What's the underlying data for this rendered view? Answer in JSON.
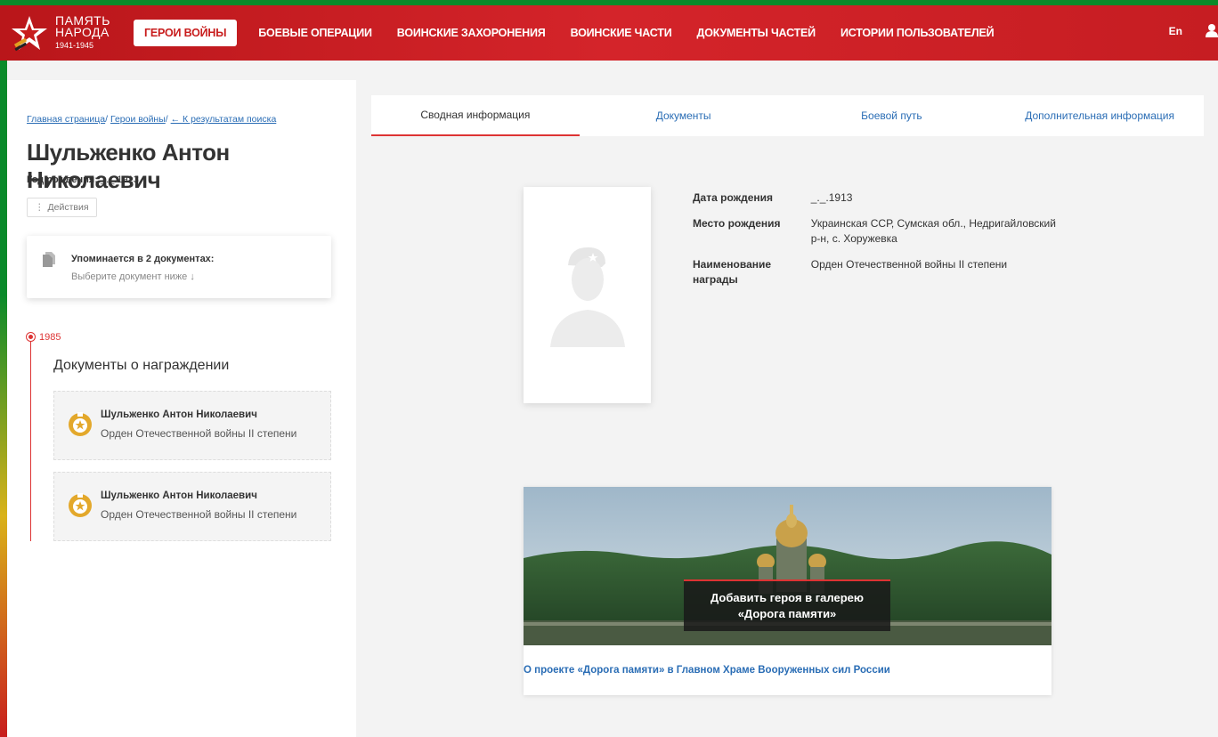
{
  "logo": {
    "line1": "ПАМЯТЬ",
    "line2": "НАРОДА",
    "years": "1941-1945"
  },
  "nav": {
    "items": [
      {
        "label": "ГЕРОИ ВОЙНЫ",
        "active": true
      },
      {
        "label": "БОЕВЫЕ ОПЕРАЦИИ"
      },
      {
        "label": "ВОИНСКИЕ ЗАХОРОНЕНИЯ"
      },
      {
        "label": "ВОИНСКИЕ ЧАСТИ"
      },
      {
        "label": "ДОКУМЕНТЫ ЧАСТЕЙ"
      },
      {
        "label": "ИСТОРИИ ПОЛЬЗОВАТЕЛЕЙ"
      }
    ],
    "lang": "En"
  },
  "breadcrumb": {
    "home": "Главная страница",
    "heroes": "Герои войны",
    "back": "← К результатам поиска",
    "sep": "/"
  },
  "hero": {
    "name": "Шульженко Антон Николаевич",
    "birth_label": "Год рождения:",
    "birth_value": " _._.1913",
    "actions": "Действия"
  },
  "mentions": {
    "title": "Упоминается в 2 документах:",
    "subtitle": "Выберите документ ниже ↓"
  },
  "timeline": {
    "year": "1985",
    "section_title": "Документы о награждении",
    "cards": [
      {
        "name": "Шульженко Антон Николаевич",
        "award": "Орден Отечественной войны II степени"
      },
      {
        "name": "Шульженко Антон Николаевич",
        "award": "Орден Отечественной войны II степени"
      }
    ]
  },
  "tabs": [
    {
      "label": "Сводная информация",
      "active": true
    },
    {
      "label": "Документы"
    },
    {
      "label": "Боевой путь"
    },
    {
      "label": "Дополнительная информация"
    }
  ],
  "info": [
    {
      "label": "Дата рождения",
      "value": "_._.1913"
    },
    {
      "label": "Место рождения",
      "value": "Украинская ССР, Сумская обл., Недригайловский р-н, с. Хоружевка"
    },
    {
      "label": "Наименование награды",
      "value": "Орден Отечественной войны II степени"
    }
  ],
  "promo": {
    "overlay_line1": "Добавить героя в галерею",
    "overlay_line2": "«Дорога памяти»",
    "link": "О проекте «Дорога памяти» в Главном Храме Вооруженных сил России"
  },
  "colors": {
    "brand_red": "#c81d1d",
    "link_blue": "#2a6db5",
    "frame_green": "#0a8a2a"
  }
}
